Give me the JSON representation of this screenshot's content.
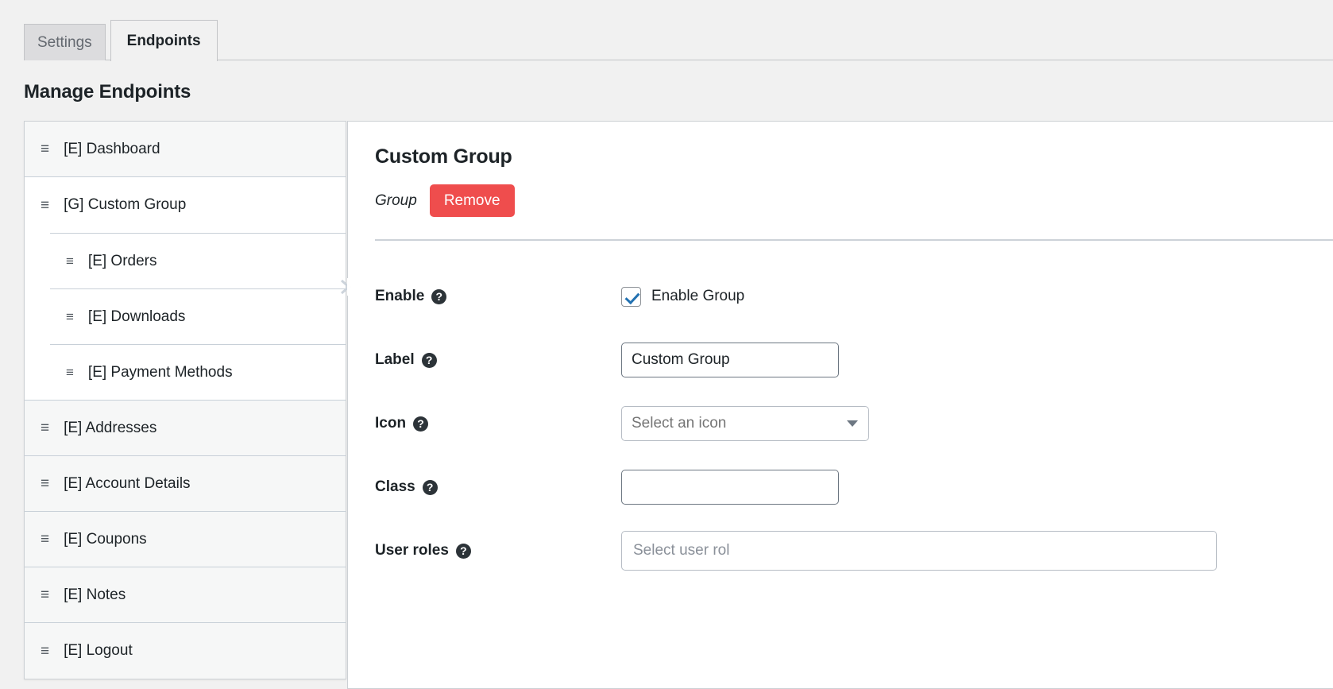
{
  "tabs": [
    {
      "label": "Settings",
      "active": false
    },
    {
      "label": "Endpoints",
      "active": true
    }
  ],
  "page": {
    "title": "Manage Endpoints"
  },
  "sidebar": {
    "handle_icon": "drag-handle-icon",
    "items": [
      {
        "label": "[E] Dashboard",
        "type": "endpoint",
        "level": 0
      },
      {
        "label": "[G] Custom Group",
        "type": "group",
        "level": 0
      },
      {
        "label": "[E] Orders",
        "type": "endpoint",
        "level": 1
      },
      {
        "label": "[E] Downloads",
        "type": "endpoint",
        "level": 1
      },
      {
        "label": "[E] Payment Methods",
        "type": "endpoint",
        "level": 1
      },
      {
        "label": "[E] Addresses",
        "type": "endpoint",
        "level": 0
      },
      {
        "label": "[E] Account Details",
        "type": "endpoint",
        "level": 0
      },
      {
        "label": "[E] Coupons",
        "type": "endpoint",
        "level": 0
      },
      {
        "label": "[E] Notes",
        "type": "endpoint",
        "level": 0
      },
      {
        "label": "[E] Logout",
        "type": "endpoint",
        "level": 0
      }
    ]
  },
  "panel": {
    "title": "Custom Group",
    "type_label": "Group",
    "remove_label": "Remove",
    "help_icon": "question-mark-icon",
    "pointer_icon": "chevron-right-icon",
    "fields": {
      "enable": {
        "label": "Enable",
        "checkbox_label": "Enable Group",
        "checked": true
      },
      "label": {
        "label": "Label",
        "value": "Custom Group",
        "placeholder": ""
      },
      "icon": {
        "label": "Icon",
        "value": "",
        "placeholder": "Select an icon",
        "arrow_icon": "caret-down-icon"
      },
      "class": {
        "label": "Class",
        "value": "",
        "placeholder": ""
      },
      "user_roles": {
        "label": "User roles",
        "value": "",
        "placeholder": "Select user rol"
      }
    }
  },
  "colors": {
    "accent_remove": "#ef4d4d",
    "checkbox_check": "#2271b1",
    "page_bg": "#f1f1f1",
    "panel_bg": "#ffffff",
    "row_bg": "#f6f7f7"
  }
}
